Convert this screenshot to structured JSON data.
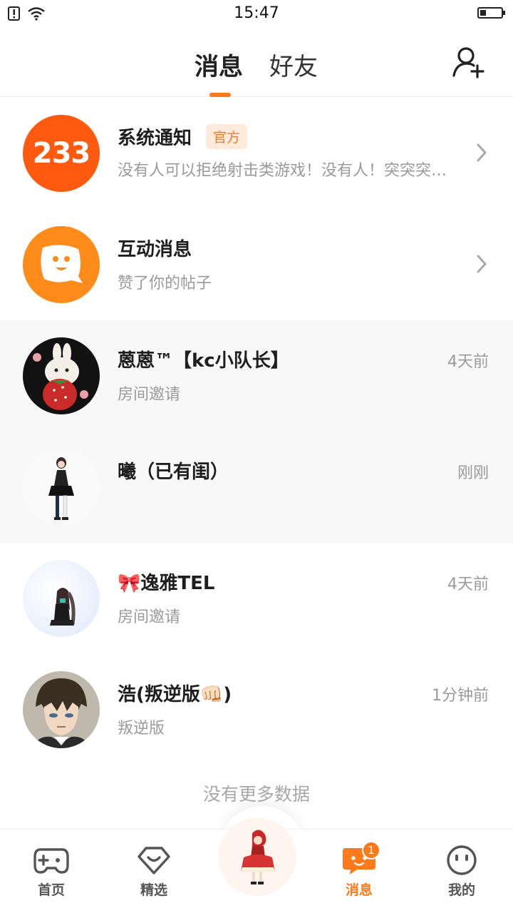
{
  "status_bar": {
    "time": "15:47",
    "battery_level": 0.3
  },
  "header": {
    "tabs": [
      {
        "label": "消息",
        "active": true
      },
      {
        "label": "好友",
        "active": false
      }
    ],
    "add_friend_icon": "add-person-icon"
  },
  "messages": [
    {
      "name": "系统通知",
      "badge": "官方",
      "preview": "没有人可以拒绝射击类游戏！没有人！突突突突...",
      "time": "",
      "avatar_text": "233",
      "avatar_color": "#ff5a10",
      "chevron": true
    },
    {
      "name": "互动消息",
      "badge": "",
      "preview": "赞了你的帖子",
      "time": "",
      "avatar_color": "#ff8c1a",
      "chevron": true
    },
    {
      "name": "蒽蒽™【kc小队长】",
      "badge": "",
      "preview": "房间邀请",
      "time": "4天前",
      "highlighted": true
    },
    {
      "name": "曦（已有闺）",
      "badge": "",
      "preview": "",
      "time": "刚刚",
      "highlighted": true
    },
    {
      "name": "🎀逸雅TEL",
      "badge": "",
      "preview": "房间邀请",
      "time": "4天前"
    },
    {
      "name": "浩(叛逆版👊🏻)",
      "badge": "",
      "preview": "叛逆版",
      "time": "1分钟前"
    }
  ],
  "no_more_text": "没有更多数据",
  "bottom_nav": {
    "items": [
      {
        "label": "首页",
        "icon": "gamepad-icon"
      },
      {
        "label": "精选",
        "icon": "heart-diamond-icon"
      },
      {
        "label": "消息",
        "icon": "chat-bubble-icon",
        "active": true,
        "badge": "1"
      },
      {
        "label": "我的",
        "icon": "face-icon"
      }
    ]
  },
  "colors": {
    "accent": "#ff7a1a",
    "text_secondary": "#9a9a9a"
  }
}
